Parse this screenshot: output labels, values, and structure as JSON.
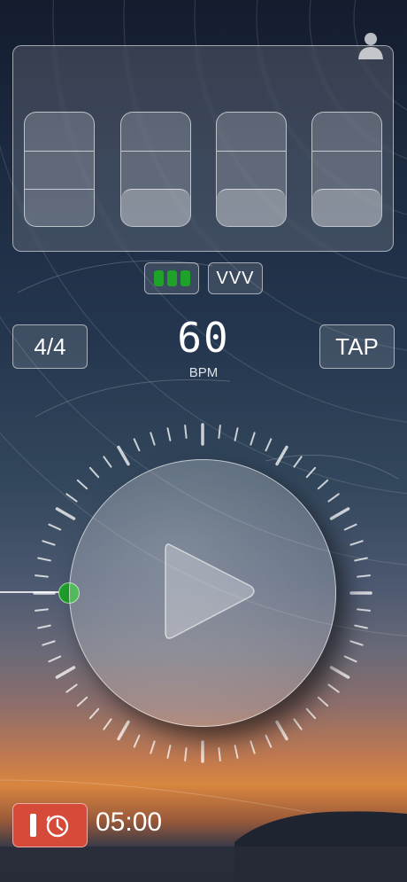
{
  "beats": [
    {
      "active_segments": 0
    },
    {
      "active_segments": 1
    },
    {
      "active_segments": 1
    },
    {
      "active_segments": 1
    }
  ],
  "sound_toggle": {
    "icon": "three-green-bars-icon",
    "color": "#1fa22a"
  },
  "accent_toggle": {
    "label": "VVV"
  },
  "time_signature": {
    "label": "4/4"
  },
  "tempo": {
    "value": "60",
    "unit": "BPM"
  },
  "tap_button": {
    "label": "TAP"
  },
  "timer": {
    "value": "05:00",
    "icon": "stopwatch-icon",
    "color": "#d64a3a"
  },
  "dial": {
    "handle_color": "#1fa22a"
  }
}
